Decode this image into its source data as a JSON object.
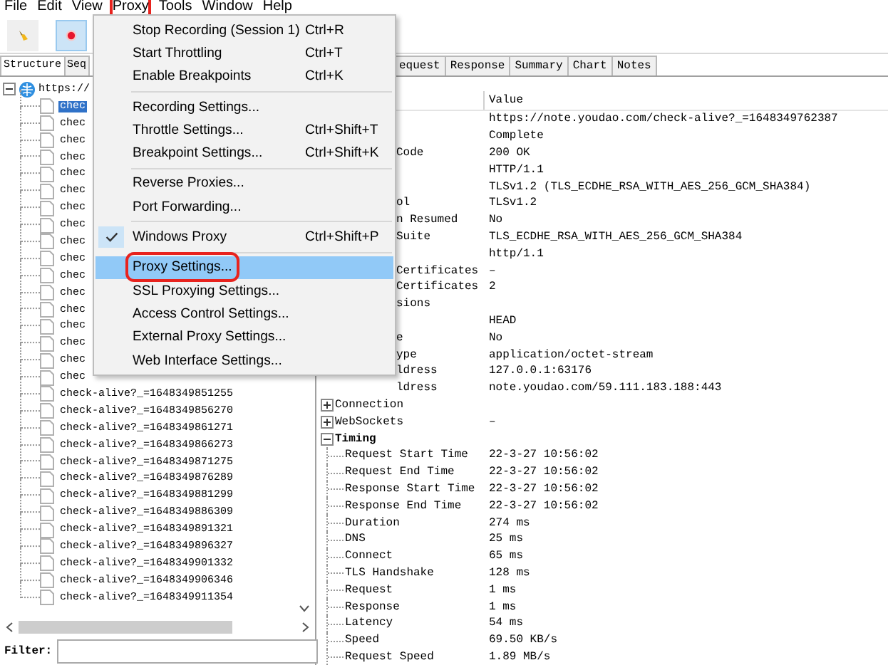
{
  "menubar": [
    {
      "label": "File",
      "boxed": false
    },
    {
      "label": "Edit",
      "boxed": false
    },
    {
      "label": "View",
      "boxed": false
    },
    {
      "label": "Proxy",
      "boxed": true
    },
    {
      "label": "Tools",
      "boxed": false
    },
    {
      "label": "Window",
      "boxed": false
    },
    {
      "label": "Help",
      "boxed": false
    }
  ],
  "toolbar": [
    {
      "kind": "broom",
      "selected": false
    },
    {
      "kind": "record",
      "selected": true
    }
  ],
  "left_tabs": [
    {
      "label": "Structure",
      "selected": true
    },
    {
      "label": "Seq",
      "selected": false
    }
  ],
  "tree": {
    "label": "https://",
    "expanded": true,
    "children": [
      {
        "label": "chec",
        "selected": true
      },
      {
        "label": "chec",
        "selected": false
      },
      {
        "label": "chec",
        "selected": false
      },
      {
        "label": "chec",
        "selected": false
      },
      {
        "label": "chec",
        "selected": false
      },
      {
        "label": "chec",
        "selected": false
      },
      {
        "label": "chec",
        "selected": false
      },
      {
        "label": "chec",
        "selected": false
      },
      {
        "label": "chec",
        "selected": false
      },
      {
        "label": "chec",
        "selected": false
      },
      {
        "label": "chec",
        "selected": false
      },
      {
        "label": "chec",
        "selected": false
      },
      {
        "label": "chec",
        "selected": false
      },
      {
        "label": "chec",
        "selected": false
      },
      {
        "label": "chec",
        "selected": false
      },
      {
        "label": "chec",
        "selected": false
      },
      {
        "label": "chec",
        "selected": false
      },
      {
        "label": "check-alive?_=1648349851255",
        "selected": false
      },
      {
        "label": "check-alive?_=1648349856270",
        "selected": false
      },
      {
        "label": "check-alive?_=1648349861271",
        "selected": false
      },
      {
        "label": "check-alive?_=1648349866273",
        "selected": false
      },
      {
        "label": "check-alive?_=1648349871275",
        "selected": false
      },
      {
        "label": "check-alive?_=1648349876289",
        "selected": false
      },
      {
        "label": "check-alive?_=1648349881299",
        "selected": false
      },
      {
        "label": "check-alive?_=1648349886309",
        "selected": false
      },
      {
        "label": "check-alive?_=1648349891321",
        "selected": false
      },
      {
        "label": "check-alive?_=1648349896327",
        "selected": false
      },
      {
        "label": "check-alive?_=1648349901332",
        "selected": false
      },
      {
        "label": "check-alive?_=1648349906346",
        "selected": false
      },
      {
        "label": "check-alive?_=1648349911354",
        "selected": false
      }
    ]
  },
  "filter": {
    "label": "Filter:"
  },
  "right_tabs": [
    {
      "label": "equest",
      "selected": false
    },
    {
      "label": "Response",
      "selected": false
    },
    {
      "label": "Summary",
      "selected": false
    },
    {
      "label": "Chart",
      "selected": false
    },
    {
      "label": "Notes",
      "selected": false
    }
  ],
  "table": {
    "columns": [
      "Value"
    ],
    "rows": [
      {
        "kind": "hidden",
        "value": "https://note.youdao.com/check-alive?_=1648349762387"
      },
      {
        "kind": "hidden",
        "value": "Complete"
      },
      {
        "kind": "cut",
        "name": "Code",
        "value": "200 OK"
      },
      {
        "kind": "hidden",
        "value": "HTTP/1.1"
      },
      {
        "kind": "hidden",
        "value": "TLSv1.2 (TLS_ECDHE_RSA_WITH_AES_256_GCM_SHA384)"
      },
      {
        "kind": "cut",
        "name": "ol",
        "value": "TLSv1.2"
      },
      {
        "kind": "cut",
        "name": "n Resumed",
        "value": "No"
      },
      {
        "kind": "cut",
        "name": "Suite",
        "value": "TLS_ECDHE_RSA_WITH_AES_256_GCM_SHA384"
      },
      {
        "kind": "hidden",
        "value": "http/1.1"
      },
      {
        "kind": "cut",
        "name": "Certificates",
        "value": "–"
      },
      {
        "kind": "cut",
        "name": "Certificates",
        "value": "2"
      },
      {
        "kind": "cut",
        "name": "sions"
      },
      {
        "kind": "hidden",
        "value": "HEAD"
      },
      {
        "kind": "cut",
        "name": "e",
        "value": "No"
      },
      {
        "kind": "cut",
        "name": "ype",
        "value": "application/octet-stream"
      },
      {
        "kind": "cut",
        "name": "ldress",
        "value": "127.0.0.1:63176"
      },
      {
        "kind": "cut",
        "name": "ldress",
        "value": "note.youdao.com/59.111.183.188:443"
      },
      {
        "kind": "group",
        "name": "Connection",
        "expanded": false
      },
      {
        "kind": "group",
        "name": "WebSockets",
        "expanded": false,
        "value": "–"
      },
      {
        "kind": "group",
        "name": "Timing",
        "expanded": true
      },
      {
        "kind": "child",
        "name": "Request Start Time",
        "value": "22-3-27 10:56:02"
      },
      {
        "kind": "child",
        "name": "Request End Time",
        "value": "22-3-27 10:56:02"
      },
      {
        "kind": "child",
        "name": "Response Start Time",
        "value": "22-3-27 10:56:02"
      },
      {
        "kind": "child",
        "name": "Response End Time",
        "value": "22-3-27 10:56:02"
      },
      {
        "kind": "child",
        "name": "Duration",
        "value": "274 ms"
      },
      {
        "kind": "child",
        "name": "DNS",
        "value": "25 ms"
      },
      {
        "kind": "child",
        "name": "Connect",
        "value": "65 ms"
      },
      {
        "kind": "child",
        "name": "TLS Handshake",
        "value": "128 ms"
      },
      {
        "kind": "child",
        "name": "Request",
        "value": "1 ms"
      },
      {
        "kind": "child",
        "name": "Response",
        "value": "1 ms"
      },
      {
        "kind": "child",
        "name": "Latency",
        "value": "54 ms"
      },
      {
        "kind": "child",
        "name": "Speed",
        "value": "69.50 KB/s"
      },
      {
        "kind": "child",
        "name": "Request Speed",
        "value": "1.89 MB/s"
      }
    ]
  },
  "menu": {
    "items": [
      {
        "kind": "item",
        "label": "Stop Recording (Session 1)",
        "shortcut": "Ctrl+R",
        "checked": false,
        "selected": false,
        "boxed": false
      },
      {
        "kind": "item",
        "label": "Start Throttling",
        "shortcut": "Ctrl+T",
        "checked": false,
        "selected": false,
        "boxed": false
      },
      {
        "kind": "item",
        "label": "Enable Breakpoints",
        "shortcut": "Ctrl+K",
        "checked": false,
        "selected": false,
        "boxed": false
      },
      {
        "kind": "separator"
      },
      {
        "kind": "item",
        "label": "Recording Settings...",
        "checked": false,
        "selected": false,
        "boxed": false
      },
      {
        "kind": "item",
        "label": "Throttle Settings...",
        "shortcut": "Ctrl+Shift+T",
        "checked": false,
        "selected": false,
        "boxed": false
      },
      {
        "kind": "item",
        "label": "Breakpoint Settings...",
        "shortcut": "Ctrl+Shift+K",
        "checked": false,
        "selected": false,
        "boxed": false
      },
      {
        "kind": "separator"
      },
      {
        "kind": "item",
        "label": "Reverse Proxies...",
        "checked": false,
        "selected": false,
        "boxed": false
      },
      {
        "kind": "item",
        "label": "Port Forwarding...",
        "checked": false,
        "selected": false,
        "boxed": false
      },
      {
        "kind": "separator"
      },
      {
        "kind": "item",
        "label": "Windows Proxy",
        "shortcut": "Ctrl+Shift+P",
        "checked": true,
        "selected": false,
        "boxed": false
      },
      {
        "kind": "separator"
      },
      {
        "kind": "item",
        "label": "Proxy Settings...",
        "checked": false,
        "selected": true,
        "boxed": true
      },
      {
        "kind": "item",
        "label": "SSL Proxying Settings...",
        "checked": false,
        "selected": false,
        "boxed": false
      },
      {
        "kind": "item",
        "label": "Access Control Settings...",
        "checked": false,
        "selected": false,
        "boxed": false
      },
      {
        "kind": "item",
        "label": "External Proxy Settings...",
        "checked": false,
        "selected": false,
        "boxed": false
      },
      {
        "kind": "item",
        "label": "Web Interface Settings...",
        "checked": false,
        "selected": false,
        "boxed": false
      }
    ]
  }
}
